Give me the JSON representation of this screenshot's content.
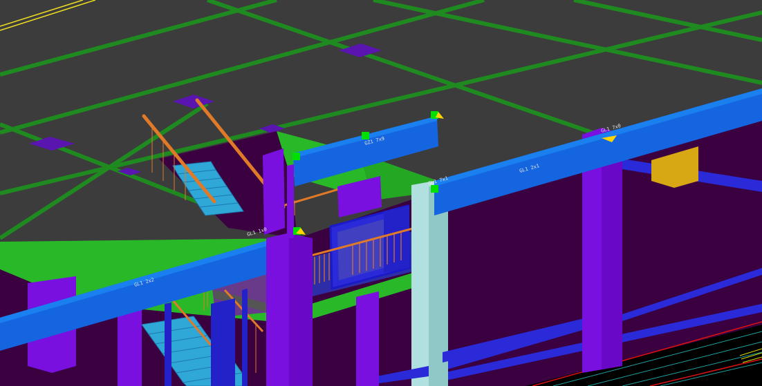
{
  "viewport": {
    "background": "#3a0040",
    "slab_color": "#3c3c3c",
    "grid_beam_color": "#1f8a1f",
    "beam_color": "#1565e0",
    "column_color": "#7a10e0",
    "stair_color": "#2fa8d8",
    "rail_color": "#e07a28",
    "grip_color": "#00e000",
    "marker_color": "#ffd400"
  },
  "labels": {
    "beam_top": "GL1 7x0",
    "beam_right": "GL1 2x1",
    "beam_corner": "GL1 7x1",
    "beam_center_top": "GZ1 7x9",
    "beam_left_mid": "GL1 1x0",
    "beam_left_low": "GL1 2x2"
  }
}
